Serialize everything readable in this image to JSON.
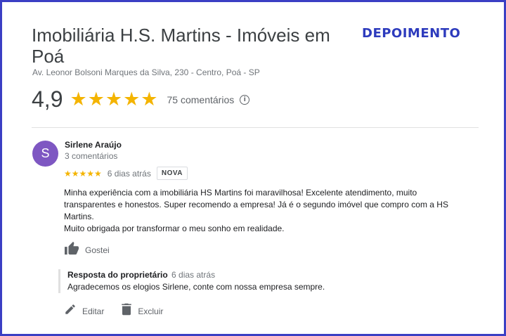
{
  "business": {
    "name": "Imobiliária H.S. Martins - Imóveis em Poá",
    "address": "Av. Leonor Bolsoni Marques da Silva, 230 - Centro, Poá - SP",
    "rating": "4,9",
    "stars": "★★★★★",
    "review_count": "75 comentários",
    "info_glyph": "i"
  },
  "label": "DEPOIMENTO",
  "review": {
    "avatar_initial": "S",
    "reviewer_name": "Sirlene Araújo",
    "reviewer_reviews": "3 comentários",
    "stars": "★★★★★",
    "rating": 5,
    "date": "6 dias atrás",
    "badge": "NOVA",
    "text_lines": [
      "Minha experiência com a imobiliária HS Martins foi maravilhosa! Excelente atendimento, muito transparentes e honestos. Super recomendo a empresa! Já é o segundo imóvel que compro com a HS Martins.",
      "Muito obrigada por transformar o meu sonho em realidade."
    ],
    "like_label": "Gostei"
  },
  "reply": {
    "owner_label": "Resposta do proprietário",
    "date": "6 dias atrás",
    "text": "Agradecemos os elogios Sirlene, conte com nossa empresa sempre."
  },
  "actions": {
    "edit_label": "Editar",
    "delete_label": "Excluir"
  },
  "colors": {
    "frame": "#3b3fc4",
    "label": "#2d3bbd",
    "star": "#f4b400",
    "avatar": "#7e57c2"
  }
}
